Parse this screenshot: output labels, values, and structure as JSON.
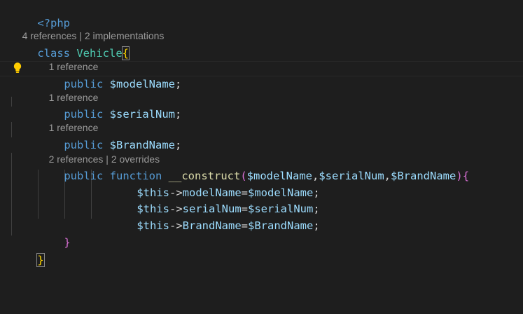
{
  "editor": {
    "lines": {
      "php_open": "<?php",
      "class_kw": "class",
      "class_name": "Vehicle",
      "brace_open": "{",
      "public1": "public",
      "var1": "$modelName",
      "semi1": ";",
      "public2": "public",
      "var2": "$serialNum",
      "semi2": ";",
      "public3": "public",
      "var3": "$BrandName",
      "semi3": ";",
      "public4": "public",
      "function_kw": "function",
      "fn_name": "__construct",
      "paren_open": "(",
      "p1": "$modelName",
      "c1": ",",
      "p2": "$serialNum",
      "c2": ",",
      "p3": "$BrandName",
      "paren_close": ")",
      "fn_brace_open": "{",
      "a1_this": "$this",
      "a1_arrow": "->",
      "a1_prop": "modelName",
      "a1_eq": "=",
      "a1_val": "$modelName",
      "a1_semi": ";",
      "a2_this": "$this",
      "a2_arrow": "->",
      "a2_prop": "serialNum",
      "a2_eq": "=",
      "a2_val": "$serialNum",
      "a2_semi": ";",
      "a3_this": "$this",
      "a3_arrow": "->",
      "a3_prop": "BrandName",
      "a3_eq": "=",
      "a3_val": "$BrandName",
      "a3_semi": ";",
      "fn_brace_close": "}",
      "class_brace_close": "}"
    },
    "codelens": {
      "class_refs": "4 references",
      "class_sep": " | ",
      "class_impls": "2 implementations",
      "prop1_refs": "1 reference",
      "prop2_refs": "1 reference",
      "prop3_refs": "1 reference",
      "ctor_refs": "2 references",
      "ctor_sep": " | ",
      "ctor_overrides": "2 overrides"
    },
    "lightbulb_icon": "lightbulb-icon",
    "colors": {
      "background": "#1e1e1e",
      "keyword": "#569cd6",
      "class_name": "#4ec9b0",
      "variable": "#9cdcfe",
      "function": "#dcdcaa",
      "bracket_level1": "#ffd700",
      "bracket_level2": "#da70d6",
      "codelens": "#999999",
      "lightbulb": "#ffcc00"
    }
  }
}
